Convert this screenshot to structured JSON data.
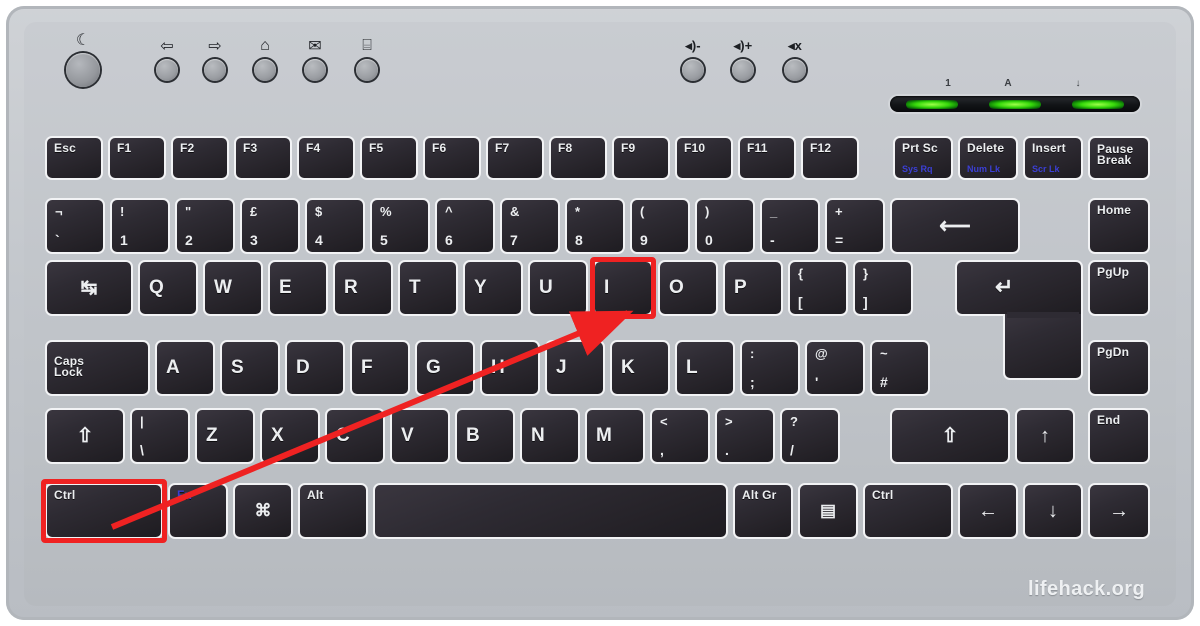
{
  "image": {
    "subject": "UK layout laptop keyboard diagram",
    "watermark": "lifehack.org",
    "highlight_color": "#ef2222",
    "key_face_color": "#2e2b33",
    "key_edge_color": "#f2f3f5",
    "chassis_color": "#c3c7cc",
    "legend_color": "#eceef0",
    "secondary_legend_color": "#3b3fd4",
    "led_color": "#37d90b"
  },
  "annotation": {
    "shortcut": "Ctrl + I",
    "highlighted_keys": [
      "Ctrl",
      "I"
    ],
    "arrow_from": "Ctrl",
    "arrow_to": "I"
  },
  "hotkeys": {
    "left": [
      {
        "icon": "sleep-moon-icon",
        "glyph": "☾",
        "size": "big"
      },
      {
        "icon": "browser-back-icon",
        "glyph": "⇦",
        "size": "small"
      },
      {
        "icon": "browser-forward-icon",
        "glyph": "⇨",
        "size": "small"
      },
      {
        "icon": "home-icon",
        "glyph": "⌂",
        "size": "small"
      },
      {
        "icon": "mail-icon",
        "glyph": "✉",
        "size": "small"
      },
      {
        "icon": "window-switch-icon",
        "glyph": "⌸",
        "size": "small"
      }
    ],
    "right": [
      {
        "icon": "volume-down-icon",
        "glyph": "◂)-",
        "size": "small"
      },
      {
        "icon": "volume-up-icon",
        "glyph": "◂)+",
        "size": "small"
      },
      {
        "icon": "mute-icon",
        "glyph": "◂x",
        "size": "small"
      }
    ]
  },
  "leds": [
    {
      "name": "num-lock-led",
      "label": "1",
      "state": "on"
    },
    {
      "name": "caps-lock-led",
      "label": "A",
      "state": "on"
    },
    {
      "name": "scroll-lock-led",
      "label": "↓",
      "state": "on"
    }
  ],
  "rows": {
    "function_row": [
      {
        "name": "esc",
        "label": "Esc"
      },
      {
        "name": "f1",
        "label": "F1"
      },
      {
        "name": "f2",
        "label": "F2"
      },
      {
        "name": "f3",
        "label": "F3"
      },
      {
        "name": "f4",
        "label": "F4"
      },
      {
        "name": "f5",
        "label": "F5"
      },
      {
        "name": "f6",
        "label": "F6"
      },
      {
        "name": "f7",
        "label": "F7"
      },
      {
        "name": "f8",
        "label": "F8"
      },
      {
        "name": "f9",
        "label": "F9"
      },
      {
        "name": "f10",
        "label": "F10"
      },
      {
        "name": "f11",
        "label": "F11"
      },
      {
        "name": "f12",
        "label": "F12"
      },
      {
        "name": "print-screen",
        "label": "Prt Sc",
        "secondary": "Sys Rq"
      },
      {
        "name": "delete",
        "label": "Delete",
        "secondary": "Num Lk"
      },
      {
        "name": "insert",
        "label": "Insert",
        "secondary": "Scr Lk"
      },
      {
        "name": "pause-break",
        "label": "Pause\nBreak"
      }
    ],
    "number_row": [
      {
        "name": "backtick",
        "top": "¬",
        "bottom": "`"
      },
      {
        "name": "digit-1",
        "top": "!",
        "bottom": "1"
      },
      {
        "name": "digit-2",
        "top": "\"",
        "bottom": "2"
      },
      {
        "name": "digit-3",
        "top": "£",
        "bottom": "3"
      },
      {
        "name": "digit-4",
        "top": "$",
        "bottom": "4"
      },
      {
        "name": "digit-5",
        "top": "%",
        "bottom": "5"
      },
      {
        "name": "digit-6",
        "top": "^",
        "bottom": "6"
      },
      {
        "name": "digit-7",
        "top": "&",
        "bottom": "7"
      },
      {
        "name": "digit-8",
        "top": "*",
        "bottom": "8"
      },
      {
        "name": "digit-9",
        "top": "(",
        "bottom": "9"
      },
      {
        "name": "digit-0",
        "top": ")",
        "bottom": "0"
      },
      {
        "name": "minus",
        "top": "_",
        "bottom": "-"
      },
      {
        "name": "equals",
        "top": "+",
        "bottom": "="
      },
      {
        "name": "backspace",
        "glyph": "⟵"
      },
      {
        "name": "home",
        "label": "Home"
      }
    ],
    "top_row": [
      {
        "name": "tab",
        "glyph": "↹"
      },
      {
        "name": "q",
        "label": "Q"
      },
      {
        "name": "w",
        "label": "W"
      },
      {
        "name": "e",
        "label": "E"
      },
      {
        "name": "r",
        "label": "R"
      },
      {
        "name": "t",
        "label": "T"
      },
      {
        "name": "y",
        "label": "Y"
      },
      {
        "name": "u",
        "label": "U"
      },
      {
        "name": "i",
        "label": "I",
        "highlighted": true
      },
      {
        "name": "o",
        "label": "O"
      },
      {
        "name": "p",
        "label": "P"
      },
      {
        "name": "bracket-left",
        "top": "{",
        "bottom": "["
      },
      {
        "name": "bracket-right",
        "top": "}",
        "bottom": "]"
      },
      {
        "name": "enter",
        "glyph": "↵"
      },
      {
        "name": "page-up",
        "label": "PgUp"
      }
    ],
    "home_row": [
      {
        "name": "caps-lock",
        "label": "Caps\nLock"
      },
      {
        "name": "a",
        "label": "A"
      },
      {
        "name": "s",
        "label": "S"
      },
      {
        "name": "d",
        "label": "D"
      },
      {
        "name": "f",
        "label": "F"
      },
      {
        "name": "g",
        "label": "G"
      },
      {
        "name": "h",
        "label": "H"
      },
      {
        "name": "j",
        "label": "J"
      },
      {
        "name": "k",
        "label": "K"
      },
      {
        "name": "l",
        "label": "L"
      },
      {
        "name": "semicolon",
        "top": ":",
        "bottom": ";"
      },
      {
        "name": "apostrophe",
        "top": "@",
        "bottom": "'"
      },
      {
        "name": "hash",
        "top": "~",
        "bottom": "#"
      },
      {
        "name": "page-down",
        "label": "PgDn"
      }
    ],
    "bottom_row": [
      {
        "name": "shift-left",
        "glyph": "⇧"
      },
      {
        "name": "backslash",
        "top": "|",
        "bottom": "\\"
      },
      {
        "name": "z",
        "label": "Z"
      },
      {
        "name": "x",
        "label": "X"
      },
      {
        "name": "c",
        "label": "C"
      },
      {
        "name": "v",
        "label": "V"
      },
      {
        "name": "b",
        "label": "B"
      },
      {
        "name": "n",
        "label": "N"
      },
      {
        "name": "m",
        "label": "M"
      },
      {
        "name": "comma",
        "top": "<",
        "bottom": ","
      },
      {
        "name": "period",
        "top": ">",
        "bottom": "."
      },
      {
        "name": "slash",
        "top": "?",
        "bottom": "/"
      },
      {
        "name": "shift-right",
        "glyph": "⇧"
      },
      {
        "name": "arrow-up",
        "glyph": "↑"
      },
      {
        "name": "end",
        "label": "End"
      }
    ],
    "modifier_row": [
      {
        "name": "ctrl-left",
        "label": "Ctrl",
        "highlighted": true
      },
      {
        "name": "fn",
        "label": "Fn",
        "style": "fn"
      },
      {
        "name": "windows",
        "glyph": "⌘"
      },
      {
        "name": "alt-left",
        "label": "Alt"
      },
      {
        "name": "space",
        "label": ""
      },
      {
        "name": "alt-gr",
        "label": "Alt Gr"
      },
      {
        "name": "menu",
        "glyph": "▤"
      },
      {
        "name": "ctrl-right",
        "label": "Ctrl"
      },
      {
        "name": "arrow-left",
        "glyph": "←"
      },
      {
        "name": "arrow-down",
        "glyph": "↓"
      },
      {
        "name": "arrow-right",
        "glyph": "→"
      }
    ]
  }
}
